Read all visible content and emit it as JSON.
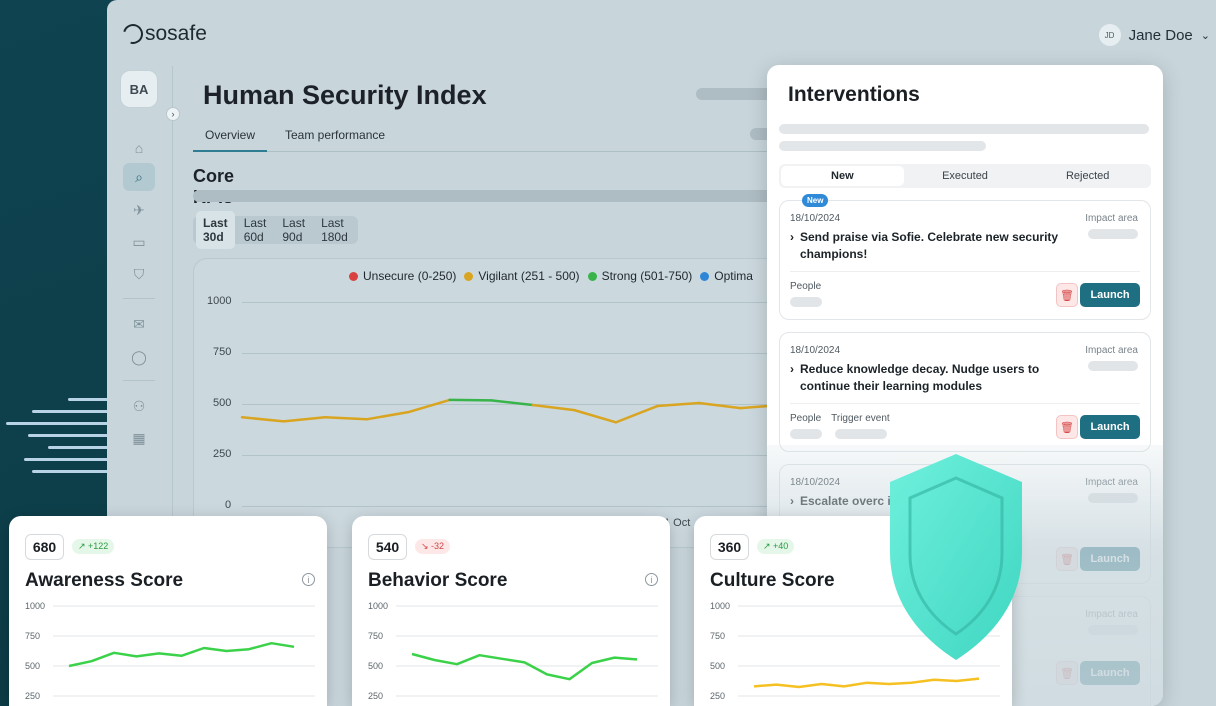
{
  "app": {
    "logo": "sosafe"
  },
  "user": {
    "initials": "JD",
    "name": "Jane Doe",
    "chevron": "⌄"
  },
  "sidebar": {
    "org_initials": "BA",
    "expand_icon": "›",
    "items": [
      {
        "name": "home-icon",
        "glyph": "⌂"
      },
      {
        "name": "security-search-icon",
        "glyph": "⌕"
      },
      {
        "name": "rocket-icon",
        "glyph": "✈"
      },
      {
        "name": "book-icon",
        "glyph": "▭"
      },
      {
        "name": "shield-icon",
        "glyph": "⛉"
      },
      {
        "name": "mail-icon",
        "glyph": "✉"
      },
      {
        "name": "chat-icon",
        "glyph": "◯"
      },
      {
        "name": "users-icon",
        "glyph": "⚇"
      },
      {
        "name": "calendar-icon",
        "glyph": "▦"
      }
    ]
  },
  "page": {
    "title": "Human Security Index",
    "tabs": [
      "Overview",
      "Team performance"
    ],
    "core_kpis": "Core KPIs",
    "ranges": [
      "Last 30d",
      "Last 60d",
      "Last 90d",
      "Last 180d"
    ],
    "x_tick_partial": "1 Oct"
  },
  "main_chart": {
    "type": "line",
    "legend": [
      {
        "label": "Unsecure (0-250)",
        "color": "#d94141"
      },
      {
        "label": "Vigilant (251 - 500)",
        "color": "#d9a521"
      },
      {
        "label": "Strong (501-750)",
        "color": "#38b44a"
      },
      {
        "label": "Optima",
        "color": "#2f86d6"
      }
    ],
    "y_ticks": [
      "1000",
      "750",
      "500",
      "250",
      "0"
    ],
    "ylim": [
      0,
      1000
    ],
    "values": [
      435,
      415,
      435,
      425,
      460,
      520,
      518,
      495,
      470,
      410,
      490,
      505,
      480,
      495
    ]
  },
  "interventions": {
    "title": "Interventions",
    "tabs": [
      "New",
      "Executed",
      "Rejected"
    ],
    "cards": [
      {
        "badge": "New",
        "date": "18/10/2024",
        "impact": "Impact area",
        "text": "Send praise via Sofie. Celebrate new security champions!",
        "meta": [
          "People"
        ],
        "launch": "Launch"
      },
      {
        "date": "18/10/2024",
        "impact": "Impact area",
        "text": "Reduce knowledge decay. Nudge users to continue their learning modules",
        "meta": [
          "People",
          "Trigger event"
        ],
        "launch": "Launch"
      },
      {
        "date": "18/10/2024",
        "impact": "Impact area",
        "text": "Escalate overc ing to Manager",
        "meta": [],
        "launch": "Launch"
      },
      {
        "impact": "Impact area",
        "launch": "Launch"
      }
    ]
  },
  "scores": [
    {
      "value": "680",
      "delta": "↗ +122",
      "trend": "up",
      "title": "Awareness Score",
      "chart_data": {
        "type": "line",
        "y_ticks": [
          "1000",
          "750",
          "500",
          "250"
        ],
        "ylim": [
          250,
          1000
        ],
        "values": [
          500,
          540,
          610,
          580,
          605,
          585,
          650,
          625,
          640,
          690,
          660
        ],
        "color": "#3bd24a"
      }
    },
    {
      "value": "540",
      "delta": "↘ -32",
      "trend": "down",
      "title": "Behavior Score",
      "chart_data": {
        "type": "line",
        "y_ticks": [
          "1000",
          "750",
          "500",
          "250"
        ],
        "ylim": [
          250,
          1000
        ],
        "values": [
          600,
          550,
          515,
          590,
          560,
          530,
          430,
          390,
          525,
          570,
          555
        ],
        "color": "#3bd24a"
      }
    },
    {
      "value": "360",
      "delta": "↗ +40",
      "trend": "up",
      "title": "Culture Score",
      "chart_data": {
        "type": "line",
        "y_ticks": [
          "1000",
          "750",
          "500",
          "250"
        ],
        "ylim": [
          250,
          1000
        ],
        "values": [
          330,
          345,
          325,
          350,
          330,
          360,
          350,
          360,
          385,
          375,
          395
        ],
        "color": "#f5c122"
      }
    }
  ],
  "colors": {
    "accent": "#1f6f82",
    "shield": "#4fe3cf"
  }
}
